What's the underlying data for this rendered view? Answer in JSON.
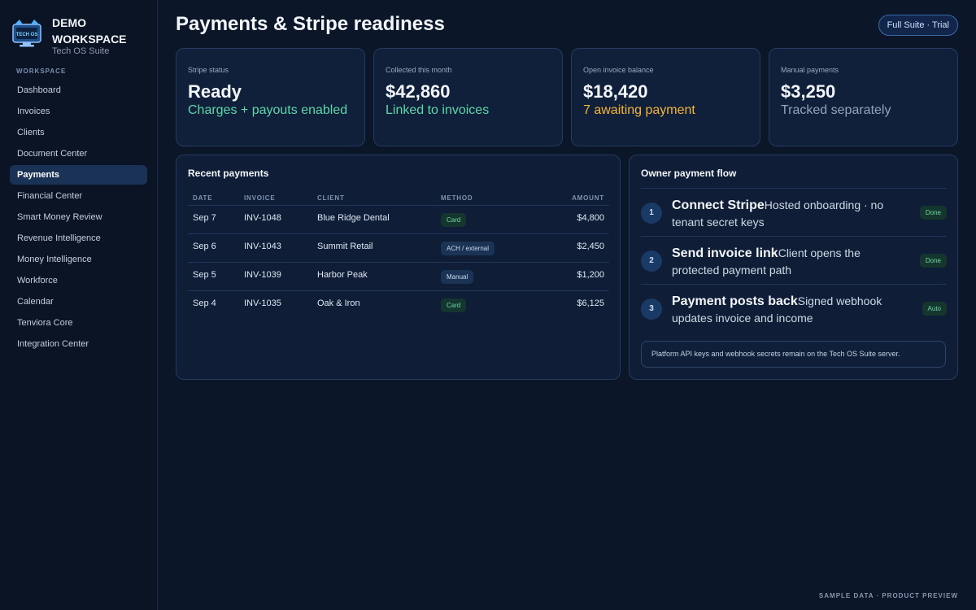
{
  "sidebar": {
    "brand_name": "DEMO WORKSPACE",
    "brand_sub": "Tech OS Suite",
    "logo_text": "TECH OS",
    "section_label": "WORKSPACE",
    "items": [
      {
        "label": "Dashboard"
      },
      {
        "label": "Invoices"
      },
      {
        "label": "Clients"
      },
      {
        "label": "Document Center"
      },
      {
        "label": "Payments",
        "active": true
      },
      {
        "label": "Financial Center"
      },
      {
        "label": "Smart Money Review"
      },
      {
        "label": "Revenue Intelligence"
      },
      {
        "label": "Money Intelligence"
      },
      {
        "label": "Workforce"
      },
      {
        "label": "Calendar"
      },
      {
        "label": "Tenviora Core"
      },
      {
        "label": "Integration Center"
      }
    ]
  },
  "header": {
    "title": "Payments & Stripe readiness",
    "plan_badge": "Full Suite · Trial"
  },
  "stats": [
    {
      "label": "Stripe status",
      "value": "Ready",
      "note": "Charges + payouts enabled",
      "tone": "green"
    },
    {
      "label": "Collected this month",
      "value": "$42,860",
      "note": "Linked to invoices",
      "tone": "green"
    },
    {
      "label": "Open invoice balance",
      "value": "$18,420",
      "note": "7 awaiting payment",
      "tone": "amber"
    },
    {
      "label": "Manual payments",
      "value": "$3,250",
      "note": "Tracked separately",
      "tone": "gray"
    }
  ],
  "recent_payments": {
    "title": "Recent payments",
    "columns": {
      "date": "DATE",
      "invoice": "INVOICE",
      "client": "CLIENT",
      "method": "METHOD",
      "amount": "AMOUNT"
    },
    "rows": [
      {
        "date": "Sep 7",
        "invoice": "INV-1048",
        "client": "Blue Ridge Dental",
        "method": "Card",
        "method_tone": "green",
        "amount": "$4,800"
      },
      {
        "date": "Sep 6",
        "invoice": "INV-1043",
        "client": "Summit Retail",
        "method": "ACH / external",
        "method_tone": "blue",
        "amount": "$2,450"
      },
      {
        "date": "Sep 5",
        "invoice": "INV-1039",
        "client": "Harbor Peak",
        "method": "Manual",
        "method_tone": "blue",
        "amount": "$1,200"
      },
      {
        "date": "Sep 4",
        "invoice": "INV-1035",
        "client": "Oak & Iron",
        "method": "Card",
        "method_tone": "green",
        "amount": "$6,125"
      }
    ]
  },
  "payment_flow": {
    "title": "Owner payment flow",
    "steps": [
      {
        "num": "1",
        "title": "Connect Stripe",
        "desc": "Hosted onboarding · no tenant secret keys",
        "status": "Done"
      },
      {
        "num": "2",
        "title": "Send invoice link",
        "desc": "Client opens the protected payment path",
        "status": "Done"
      },
      {
        "num": "3",
        "title": "Payment posts back",
        "desc": "Signed webhook updates invoice and income",
        "status": "Auto"
      }
    ],
    "note": "Platform API keys and webhook secrets remain on the Tech OS Suite server."
  },
  "footer": {
    "label": "SAMPLE DATA · PRODUCT PREVIEW"
  },
  "colors": {
    "accent": "#1b3257",
    "success": "#5fd6a8",
    "warning": "#f4b43a",
    "background": "#0b1628"
  }
}
